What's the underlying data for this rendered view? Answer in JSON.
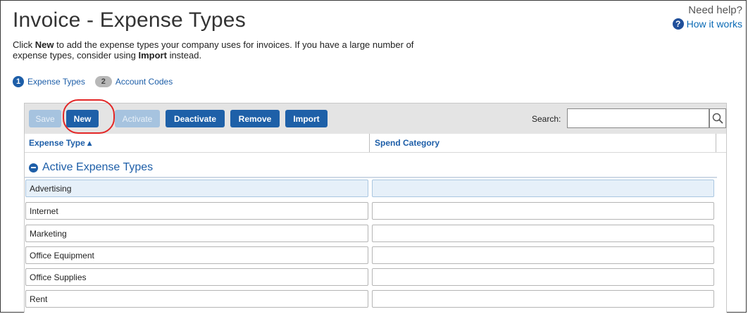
{
  "header": {
    "title": "Invoice - Expense Types",
    "need_help": "Need help?",
    "how_it_works": "How it works"
  },
  "description": {
    "part1": "Click ",
    "new_bold": "New",
    "part2": " to add the expense types your company uses for invoices. If you have a large number of expense types, consider using ",
    "import_bold": "Import",
    "part3": " instead."
  },
  "steps": [
    {
      "number": "1",
      "label": "Expense Types",
      "active": true
    },
    {
      "number": "2",
      "label": "Account Codes",
      "active": false
    }
  ],
  "toolbar": {
    "save": "Save",
    "new": "New",
    "activate": "Activate",
    "deactivate": "Deactivate",
    "remove": "Remove",
    "import": "Import",
    "search_label": "Search:",
    "search_value": ""
  },
  "table": {
    "columns": [
      "Expense Type ▴",
      "Spend Category"
    ],
    "group_label": "Active Expense Types",
    "rows": [
      {
        "expense_type": "Advertising",
        "spend_category": "",
        "selected": true
      },
      {
        "expense_type": "Internet",
        "spend_category": ""
      },
      {
        "expense_type": "Marketing",
        "spend_category": ""
      },
      {
        "expense_type": "Office Equipment",
        "spend_category": ""
      },
      {
        "expense_type": "Office Supplies",
        "spend_category": ""
      },
      {
        "expense_type": "Rent",
        "spend_category": ""
      }
    ]
  },
  "colors": {
    "accent": "#1e60a8",
    "disabled_button": "#a6c3df",
    "highlight_ring": "#e32626"
  }
}
